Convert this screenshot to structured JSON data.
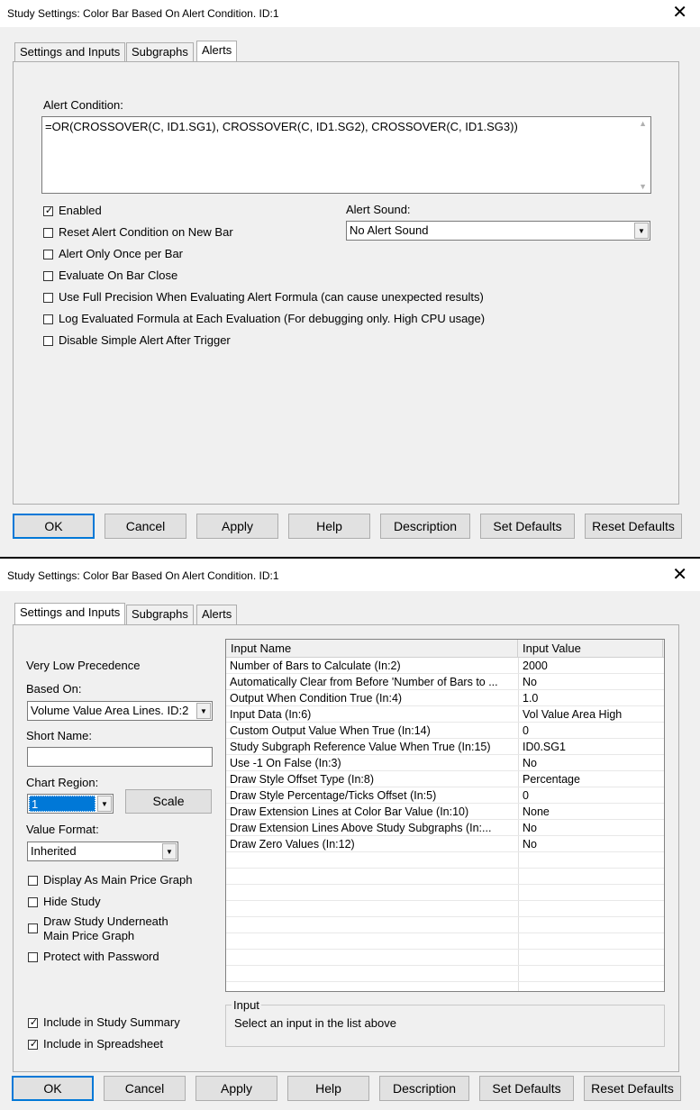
{
  "window1": {
    "title": "Study Settings: Color Bar Based On Alert Condition. ID:1",
    "close": "✕",
    "tabs": [
      "Settings and Inputs",
      "Subgraphs",
      "Alerts"
    ],
    "alert_condition_label": "Alert Condition:",
    "alert_formula": "=OR(CROSSOVER(C, ID1.SG1), CROSSOVER(C, ID1.SG2), CROSSOVER(C, ID1.SG3))",
    "checkboxes": [
      {
        "label": "Enabled",
        "checked": true
      },
      {
        "label": "Reset Alert Condition on New Bar",
        "checked": false
      },
      {
        "label": "Alert Only Once per Bar",
        "checked": false
      },
      {
        "label": "Evaluate On Bar Close",
        "checked": false
      },
      {
        "label": "Use Full Precision When Evaluating Alert Formula (can cause unexpected results)",
        "checked": false
      },
      {
        "label": "Log Evaluated Formula at Each Evaluation (For debugging only. High CPU usage)",
        "checked": false
      },
      {
        "label": "Disable Simple Alert After Trigger",
        "checked": false
      }
    ],
    "alert_sound_label": "Alert Sound:",
    "alert_sound_value": "No Alert Sound",
    "buttons": [
      "OK",
      "Cancel",
      "Apply",
      "Help",
      "Description",
      "Set Defaults",
      "Reset Defaults"
    ]
  },
  "window2": {
    "title": "Study Settings: Color Bar Based On Alert Condition. ID:1",
    "close": "✕",
    "tabs": [
      "Settings and Inputs",
      "Subgraphs",
      "Alerts"
    ],
    "precedence": "Very Low Precedence",
    "based_on_label": "Based On:",
    "based_on_value": "Volume Value Area Lines. ID:2",
    "short_name_label": "Short Name:",
    "short_name_value": "",
    "chart_region_label": "Chart Region:",
    "chart_region_value": "1",
    "scale_button": "Scale",
    "value_format_label": "Value Format:",
    "value_format_value": "Inherited",
    "checkboxes": [
      {
        "label": "Display As Main Price Graph",
        "checked": false
      },
      {
        "label": "Hide Study",
        "checked": false
      },
      {
        "label": "Draw Study Underneath",
        "label2": "Main Price Graph",
        "checked": false
      },
      {
        "label": "Protect with Password",
        "checked": false
      }
    ],
    "checkboxes_bottom": [
      {
        "label": "Include in Study Summary",
        "checked": true
      },
      {
        "label": "Include in Spreadsheet",
        "checked": true
      }
    ],
    "inputs_table": {
      "columns": [
        "Input Name",
        "Input Value"
      ],
      "rows": [
        [
          "Number of Bars to Calculate  (In:2)",
          "2000"
        ],
        [
          "Automatically Clear from Before 'Number of Bars to ...",
          "No"
        ],
        [
          "Output When Condition True  (In:4)",
          "1.0"
        ],
        [
          "Input Data  (In:6)",
          "Vol Value Area High"
        ],
        [
          "Custom Output Value When True  (In:14)",
          "0"
        ],
        [
          "Study Subgraph Reference Value When True  (In:15)",
          "ID0.SG1"
        ],
        [
          "Use -1 On False  (In:3)",
          "No"
        ],
        [
          "Draw Style Offset Type  (In:8)",
          "Percentage"
        ],
        [
          "Draw Style Percentage/Ticks Offset  (In:5)",
          "0"
        ],
        [
          "Draw Extension Lines at Color Bar Value  (In:10)",
          "None"
        ],
        [
          "Draw Extension Lines Above Study Subgraphs  (In:...",
          "No"
        ],
        [
          "Draw Zero Values  (In:12)",
          "No"
        ]
      ],
      "empty_rows": 10
    },
    "input_group_label": "Input",
    "input_hint": "Select an input in the list above",
    "buttons": [
      "OK",
      "Cancel",
      "Apply",
      "Help",
      "Description",
      "Set Defaults",
      "Reset Defaults"
    ]
  }
}
